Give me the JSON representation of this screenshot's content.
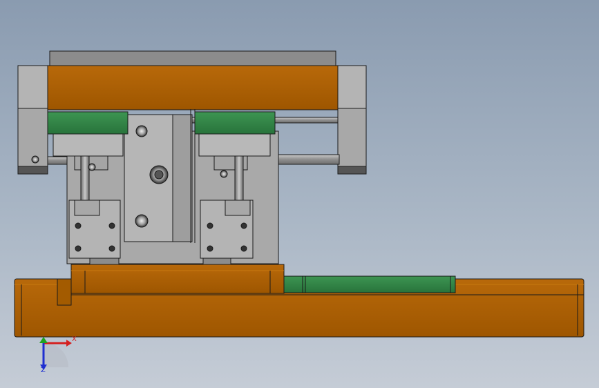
{
  "viewport": {
    "background_top": "#8a9bb0",
    "background_bottom": "#c5ccd6"
  },
  "colors": {
    "orange_body": "#a35b00",
    "orange_highlight": "#c8780f",
    "green_block": "#2e7d42",
    "green_rail": "#3e9a55",
    "gray_part": "#b4b4b4",
    "gray_dark": "#8c8c8c",
    "steel": "#9a9a9a",
    "edge": "#1a1a1a"
  },
  "triad": {
    "x_label": "X",
    "z_label": "Z",
    "x_color": "#d42020",
    "y_color": "#1fa31f",
    "z_color": "#1f2fd0"
  }
}
